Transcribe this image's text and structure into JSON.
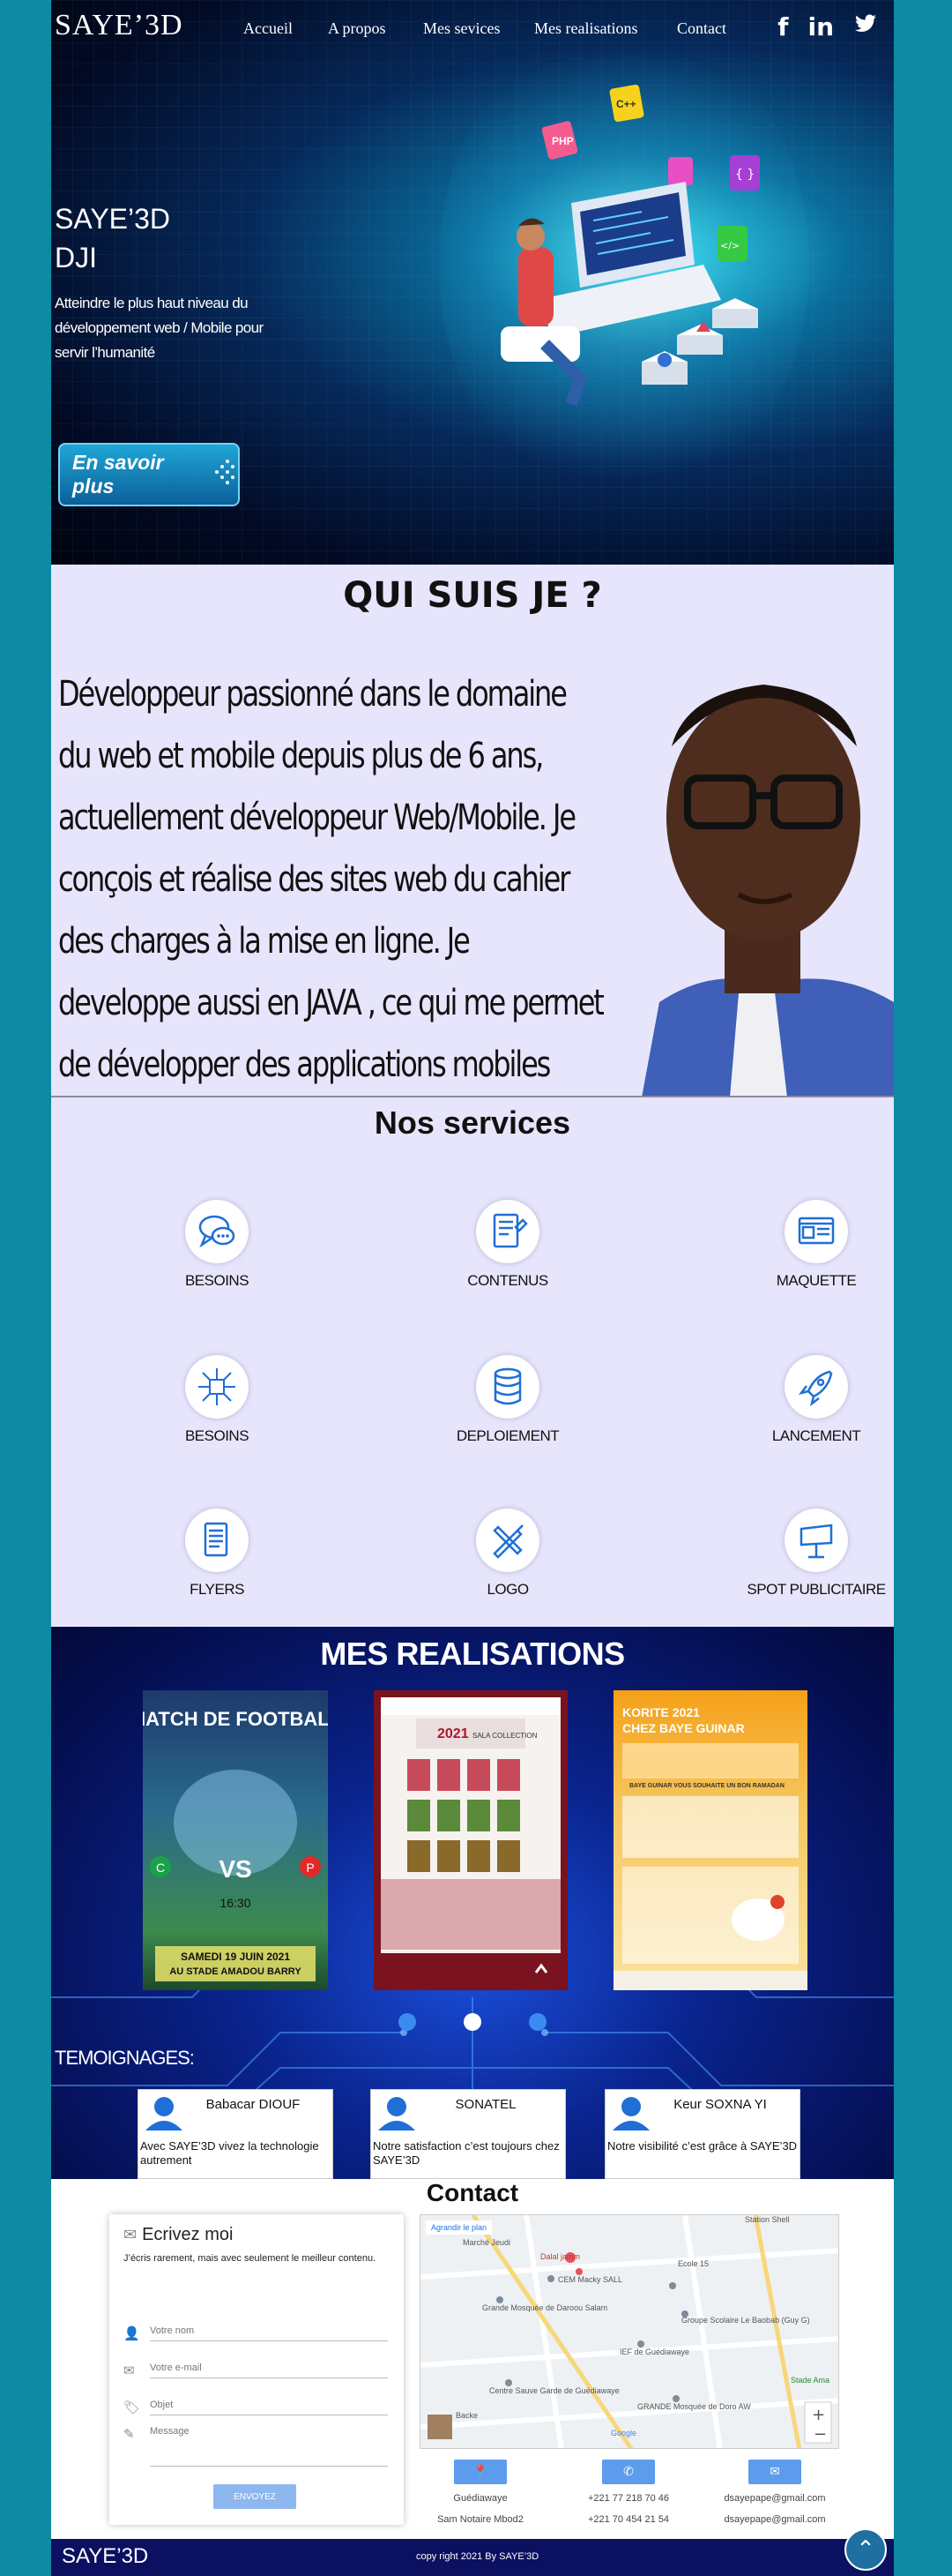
{
  "header": {
    "brand": "SAYE’3D",
    "nav": [
      {
        "label": "Accueil"
      },
      {
        "label": "A propos"
      },
      {
        "label": "Mes sevices"
      },
      {
        "label": "Mes realisations"
      },
      {
        "label": "Contact"
      }
    ],
    "social": {
      "facebook": "f",
      "linkedin": "in",
      "twitter": "🐦"
    }
  },
  "hero": {
    "title_line1": "SAYE’3D",
    "title_line2": "DJI",
    "tagline": "Atteindre le plus haut niveau du développement web /  Mobile pour servir l’humanité",
    "cta_label": "En savoir plus",
    "badges": [
      "C++",
      "PHP",
      "{ }",
      "</>"
    ]
  },
  "about": {
    "title": "QUI SUIS JE ?",
    "text": "Développeur passionné dans le domaine du web et mobile depuis plus de 6 ans, actuellement développeur Web/Mobile. Je conçois et réalise des sites web du cahier des charges à la mise en ligne. Je developpe aussi en JAVA , ce qui me permet de développer des applications mobiles"
  },
  "services": {
    "title": "Nos services",
    "items": [
      {
        "label": "BESOINS",
        "icon": "chat-bubble-icon"
      },
      {
        "label": "CONTENUS",
        "icon": "document-edit-icon"
      },
      {
        "label": "MAQUETTE",
        "icon": "layout-icon"
      },
      {
        "label": "BESOINS",
        "icon": "circuit-icon"
      },
      {
        "label": "DEPLOIEMENT",
        "icon": "database-icon"
      },
      {
        "label": "LANCEMENT",
        "icon": "rocket-icon"
      },
      {
        "label": "FLYERS",
        "icon": "flyer-icon"
      },
      {
        "label": "LOGO",
        "icon": "design-tools-icon"
      },
      {
        "label": "SPOT PUBLICITAIRE",
        "icon": "billboard-icon"
      }
    ]
  },
  "realisations": {
    "title": "MES REALISATIONS",
    "cards": [
      {
        "heading": "MATCH DE FOOTBALL",
        "left": "C",
        "vs": "VS",
        "right": "P",
        "time": "16:30",
        "date": "SAMEDI 19 JUIN 2021",
        "place": "AU STADE AMADOU BARRY"
      },
      {
        "heading": "2021",
        "sub": "SALA COLLECTION"
      },
      {
        "heading": "KORITE 2021",
        "sub": "CHEZ BAYE GUINAR",
        "note": "BAYE GUINAR VOUS SOUHAITE UN BON RAMADAN"
      }
    ],
    "active_slide": 2,
    "slides": 3
  },
  "testimonials": {
    "title": "TEMOIGNAGES:",
    "items": [
      {
        "name": "Babacar DIOUF",
        "quote": "Avec SAYE’3D vivez la technologie autrement"
      },
      {
        "name": "SONATEL",
        "quote": "Notre satisfaction c’est  toujours chez SAYE’3D"
      },
      {
        "name": "Keur SOXNA YI",
        "quote": "Notre visibilité c’est grâce à SAYE’3D"
      }
    ]
  },
  "contact": {
    "title": "Contact",
    "form_title": "Ecrivez moi",
    "intro": "J’écris rarement, mais avec seulement le meilleur contenu.",
    "name_placeholder": "Votre nom",
    "email_placeholder": "Votre e-mail",
    "subject_placeholder": "Objet",
    "message_placeholder": "Message",
    "send_label": "ENVOYEZ",
    "map": {
      "link": "Agrandir le plan",
      "labels": [
        "Marché Jeudi",
        "Dalal jamm",
        "CEM Macky SALL",
        "Grande Mosquée de Daroou Salam",
        "Ecole 15",
        "Groupe Scolaire Le Baobab (Guy G)",
        "IEF de Guédiawaye",
        "Centre Sauve Garde de Guédiawaye",
        "GRANDE Mosquée de Doro AW",
        "Stade Ama",
        "Station Shell",
        "Google",
        "Backe"
      ]
    },
    "columns": [
      {
        "icon": "location-pin-icon",
        "line1": "Guédiawaye",
        "line2": "Sam Notaire Mbod2"
      },
      {
        "icon": "phone-icon",
        "line1": "+221 77 218 70 46",
        "line2": "+221 70 454 21 54"
      },
      {
        "icon": "envelope-icon",
        "line1": "dsayepape@gmail.com",
        "line2": "dsayepape@gmail.com"
      }
    ]
  },
  "footer": {
    "brand": "SAYE’3D",
    "copyright": "copy right  2021 By SAYE’3D"
  },
  "colors": {
    "accent": "#0e8aa3",
    "footer": "#0b1060",
    "button": "#5d9cec"
  }
}
